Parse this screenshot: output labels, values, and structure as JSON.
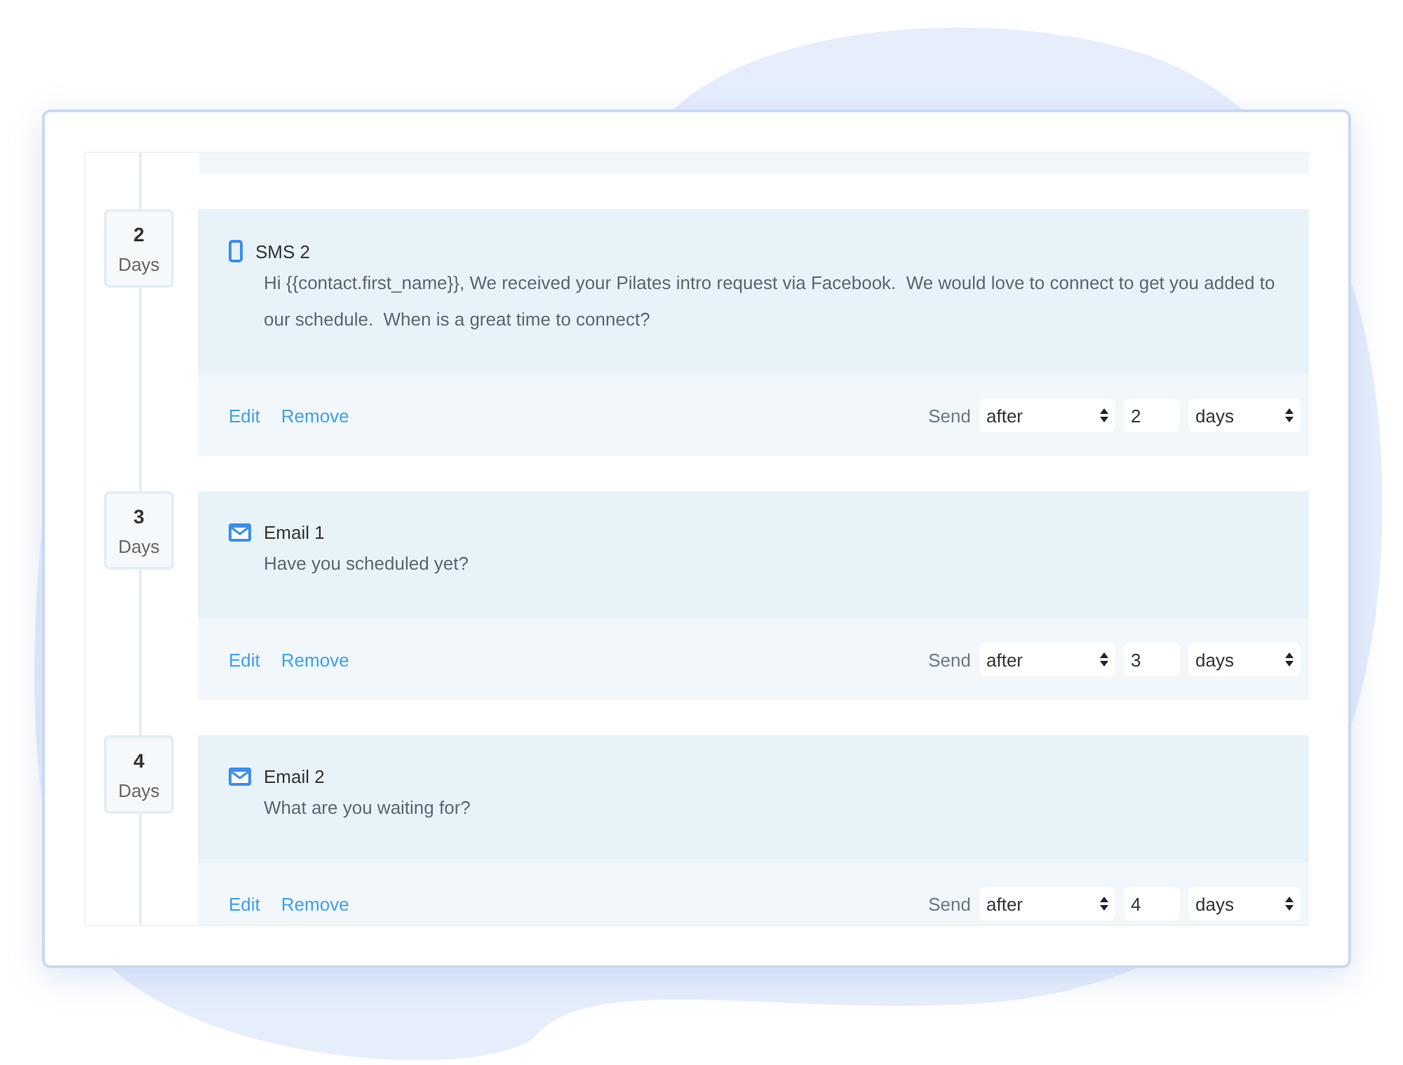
{
  "steps": [
    {
      "day": "2",
      "unit": "Days",
      "kind": "sms",
      "title": "SMS 2",
      "message": "Hi {{contact.first_name}}, We received your Pilates intro request via Facebook.  We would love to connect to get you added to our schedule.  When is a great time to connect?",
      "actions": [
        "Edit",
        "Remove"
      ],
      "send_label": "Send",
      "timing": "after",
      "amount": "2",
      "period": "days"
    },
    {
      "day": "3",
      "unit": "Days",
      "kind": "email",
      "title": "Email 1",
      "message": "Have you scheduled yet?",
      "actions": [
        "Edit",
        "Remove"
      ],
      "send_label": "Send",
      "timing": "after",
      "amount": "3",
      "period": "days"
    },
    {
      "day": "4",
      "unit": "Days",
      "kind": "email",
      "title": "Email 2",
      "message": "What are you waiting for?",
      "actions": [
        "Edit",
        "Remove"
      ],
      "send_label": "Send",
      "timing": "after",
      "amount": "4",
      "period": "days"
    }
  ]
}
